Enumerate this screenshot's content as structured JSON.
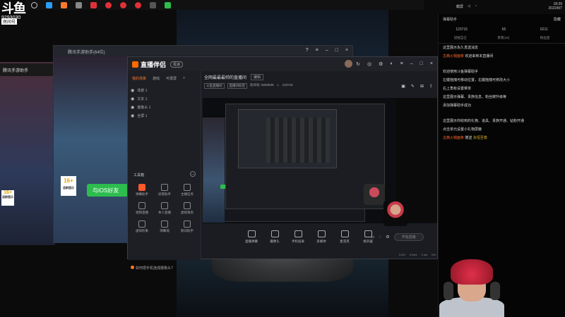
{
  "overlay": {
    "logo_main": "斗鱼",
    "logo_sub": "房间号",
    "room_id": "9293030"
  },
  "taskbar": {
    "icons": [
      "search-icon",
      "edge-browser-icon",
      "douyu-icon",
      "record-icon",
      "red-app-icon",
      "red-app-icon",
      "red-app-icon",
      "red-app-icon",
      "game-icon",
      "green-app-icon"
    ]
  },
  "tray": {
    "text": "截屏",
    "time": "18:39",
    "date": "2022/8/7"
  },
  "background_window": {
    "title": "腾讯手游助手",
    "tag16": "16+",
    "tag16_sub": "适龄提示",
    "ios_button": "与iOS好友"
  },
  "back_window": {
    "title": "腾讯手游助手(64位)",
    "ios_button": "与iOS好友",
    "tag16": "16+",
    "tag16_sub": "适龄提示"
  },
  "main_window": {
    "app_name": "直播伴侣",
    "badge": "极速",
    "tabs": [
      "我的场景",
      "游戏",
      "可录屏",
      "+"
    ],
    "active_tab": "我的场景",
    "sources": [
      {
        "label": "场景 1"
      },
      {
        "label": "文本 1"
      },
      {
        "label": "摄像头 1"
      },
      {
        "label": "全屏 1"
      }
    ],
    "tools_title": "工具箱",
    "tools": [
      {
        "label": "弹幕助手"
      },
      {
        "label": "房管助手"
      },
      {
        "label": "主播任务"
      },
      {
        "label": "视频直播"
      },
      {
        "label": "本人直播"
      },
      {
        "label": "虚拟角色"
      },
      {
        "label": "虚拟形象"
      },
      {
        "label": "弹幕墙"
      },
      {
        "label": "歌词助手"
      }
    ],
    "bottom_note": "如何把手机连成摄像头?",
    "room_title": "全网最最最帅的直播间",
    "room_title_tag": "编辑",
    "header_chips": [
      "斗鱼直播间",
      "直播间标签"
    ],
    "room_meta": "房间号: 9293030",
    "viewers": "123715",
    "controls": [
      {
        "label": "直播弹幕"
      },
      {
        "label": "摄像头"
      },
      {
        "label": "手机投屏"
      },
      {
        "label": "多媒体"
      },
      {
        "label": "麦克风"
      },
      {
        "label": "扬声器"
      }
    ],
    "start_button": "开始直播",
    "status": [
      "0.0%",
      "0 kb/s",
      "0 ms",
      "0%"
    ]
  },
  "chat_panel": {
    "title": "弹幕助手",
    "close_label": "隐藏",
    "stats": [
      "123715",
      "65",
      "6211"
    ],
    "tabs": [
      "说给自己",
      "贵宾(12)",
      "粉丝团"
    ],
    "messages": [
      {
        "text": "这里展示永久发送消息",
        "user": "",
        "extra": ""
      },
      {
        "text": "欢迎来到本直播间",
        "user": "古典火锅面条",
        "extra": ""
      },
      {
        "text": "欢迎使用斗鱼弹幕助手",
        "user": "",
        "extra": "",
        "gap": true
      },
      {
        "text": "左键拖拽可移动位置，右键拖拽可修改大小",
        "user": "",
        "extra": ""
      },
      {
        "text": "右上角有设置菜单",
        "user": "",
        "extra": ""
      },
      {
        "text": "这里展示弹幕、贵族信息、粉丝牌升级等",
        "user": "",
        "extra": ""
      },
      {
        "text": "添加弹幕助手成功",
        "user": "",
        "extra": ""
      },
      {
        "text": "这里展示你收到的礼物、道具、贵族开通、钻粉开通",
        "user": "",
        "extra": "",
        "gap": true
      },
      {
        "text": "点击单元设置小礼物屏蔽",
        "user": "",
        "extra": ""
      },
      {
        "text": "赠送",
        "user": "古典火锅面条",
        "extra": "永恒至尊"
      }
    ]
  }
}
